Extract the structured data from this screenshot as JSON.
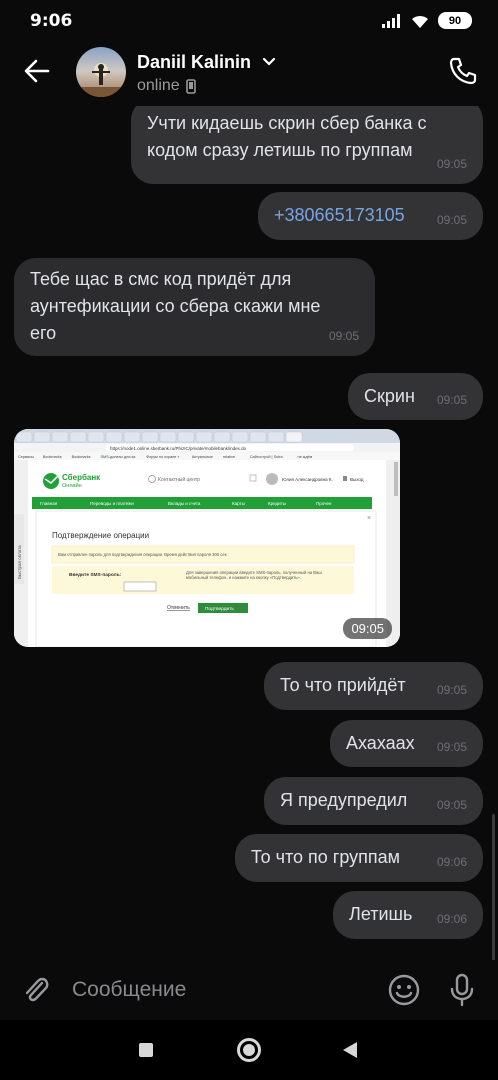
{
  "status_bar": {
    "time": "9:06",
    "battery": "90"
  },
  "header": {
    "name": "Daniil Kalinin",
    "status": "online"
  },
  "messages": [
    {
      "text": "Учти кидаешь скрин сбер банка с\nкодом сразу летишь по группам",
      "time": "09:05"
    },
    {
      "text": "+380665173105",
      "time": "09:05"
    },
    {
      "text": "Тебе щас в смс код придёт для\nаунтефикации со сбера скажи мне\nего",
      "time": "09:05"
    },
    {
      "text": "Скрин",
      "time": "09:05"
    },
    {
      "text": "То что прийдёт",
      "time": "09:05"
    },
    {
      "text": "Ахахаах",
      "time": "09:05"
    },
    {
      "text": "Я предупредил",
      "time": "09:05"
    },
    {
      "text": "То что по группам",
      "time": "09:06"
    },
    {
      "text": "Летишь",
      "time": "09:06"
    }
  ],
  "photo": {
    "time": "09:05",
    "url": "https://node1.online.sberbank.ru/PhizIC/private/mobilebank/index.do",
    "bank_name": "Сбербанк",
    "bank_sub": "Онлайн",
    "contact_center": "Контактный центр",
    "user_name": "Юлия Александровна К.",
    "logout": "Выход",
    "menu": [
      "Главная",
      "Переводы и платежи",
      "Вклады и счета",
      "Карты",
      "Кредиты",
      "Прочее"
    ],
    "side_tab": "Быстрая оплата",
    "dialog_title": "Подтверждение операции",
    "info_text": "Вам отправлен пароль для подтверждения операции. Время действия пароля 300 сек",
    "sms_label": "Введите SMS-пароль:",
    "sms_hint": "Для завершения операции введите SMS-пароль, полученный на Ваш мобильный телефон, и нажмите на кнопку «Подтвердить».",
    "cancel": "Отменить",
    "confirm": "Подтвердить",
    "bookmarks": [
      "Сервисы",
      "Bookmarks",
      "Bookmarks",
      "SMS-донаты для ка",
      "Форум по охране т",
      "Актуальные",
      "relative",
      "Сайтострой | Sutra",
      "ne ждём"
    ]
  },
  "composer": {
    "placeholder": "Сообщение"
  },
  "colors": {
    "bubble_in": "#2c2c2e",
    "bubble_out": "#333336",
    "link": "#7aa5e0",
    "sber_green": "#21a038"
  }
}
